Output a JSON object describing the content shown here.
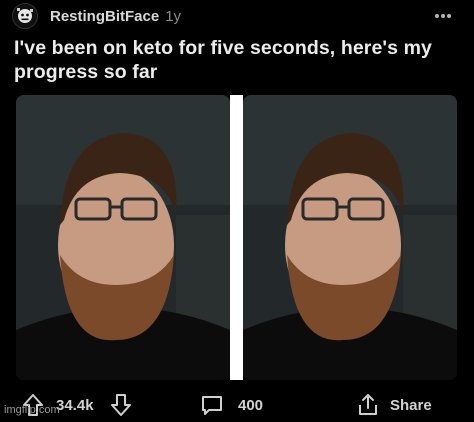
{
  "post": {
    "username": "RestingBitFace",
    "age": "1y",
    "title": "I've been on keto for five seconds, here's my progress so far"
  },
  "actions": {
    "upvote_icon": "upvote-arrow-icon",
    "score": "34.4k",
    "downvote_icon": "downvote-arrow-icon",
    "comments_icon": "comment-bubble-icon",
    "comment_count": "400",
    "share_icon": "share-icon",
    "share_label": "Share",
    "more_icon": "more-dots-icon"
  },
  "images": [
    {
      "label": "before-photo"
    },
    {
      "label": "after-photo"
    }
  ],
  "watermark": "imgflip.com",
  "colors": {
    "background": "#000000",
    "text": "#e6e6e6",
    "muted": "#8a8a8a",
    "divider": "#ffffff"
  }
}
